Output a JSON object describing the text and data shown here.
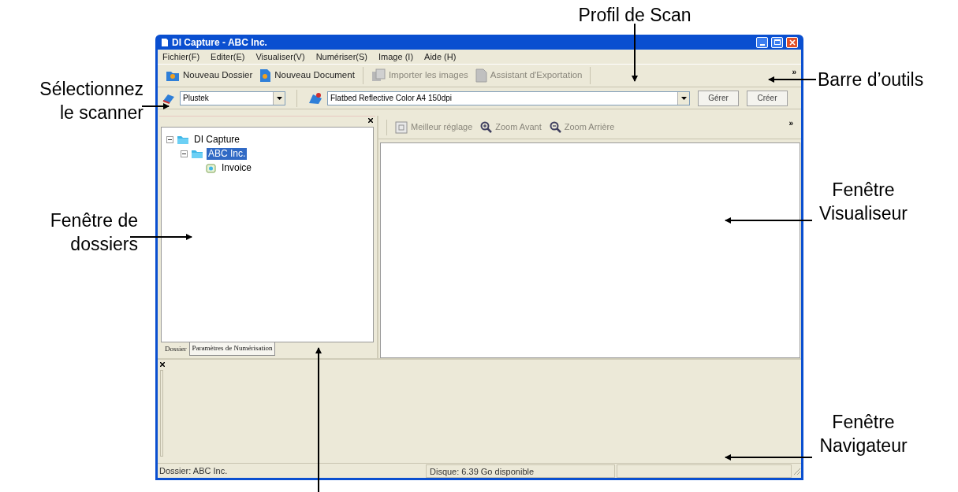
{
  "window": {
    "title": "DI Capture - ABC Inc."
  },
  "menu": [
    "Fichier(F)",
    "Editer(E)",
    "Visualiser(V)",
    "Numériser(S)",
    "Image (I)",
    "Aide (H)"
  ],
  "toolbar": [
    {
      "label": "Nouveau Dossier",
      "disabled": false,
      "kind": "folder"
    },
    {
      "label": "Nouveau Document",
      "disabled": false,
      "kind": "document"
    },
    {
      "label": "Importer les images",
      "disabled": true,
      "kind": "import"
    },
    {
      "label": "Assistant d'Exportation",
      "disabled": true,
      "kind": "export"
    }
  ],
  "toolbar_chevron": "»",
  "scanner": {
    "value": "Plustek"
  },
  "profile": {
    "value": "Flatbed Reflective Color A4 150dpi"
  },
  "profile_buttons": [
    "Gérer",
    "Créer"
  ],
  "folder_tree": [
    {
      "label": "DI Capture",
      "expanded": true,
      "selected": false,
      "kind": "folder",
      "children": [
        {
          "label": "ABC Inc.",
          "expanded": true,
          "selected": true,
          "kind": "folder",
          "children": [
            {
              "label": "Invoice",
              "selected": false,
              "kind": "document"
            }
          ]
        }
      ]
    }
  ],
  "folder_tabs": [
    {
      "label": "Dossier",
      "selected": true
    },
    {
      "label": "Paramètres de Numérisation",
      "selected": false
    }
  ],
  "viewer_toolbar": [
    {
      "label": "Meilleur réglage",
      "disabled": true,
      "kind": "fit"
    },
    {
      "label": "Zoom Avant",
      "disabled": true,
      "kind": "zoom-in"
    },
    {
      "label": "Zoom Arrière",
      "disabled": true,
      "kind": "zoom-out"
    }
  ],
  "viewer_chevron": "»",
  "status_bar": [
    "Dossier: ABC Inc.",
    "Disque: 6.39 Go disponible"
  ],
  "annotations": [
    {
      "lines": [
        "Profil de Scan"
      ]
    },
    {
      "lines": [
        "Barre d’outils"
      ]
    },
    {
      "lines": [
        "Sélectionnez",
        "le scanner"
      ]
    },
    {
      "lines": [
        "Fenêtre de",
        "dossiers"
      ]
    },
    {
      "lines": [
        "Fenêtre",
        "Visualiseur"
      ]
    },
    {
      "lines": [
        "Fenêtre",
        "Navigateur"
      ]
    }
  ]
}
